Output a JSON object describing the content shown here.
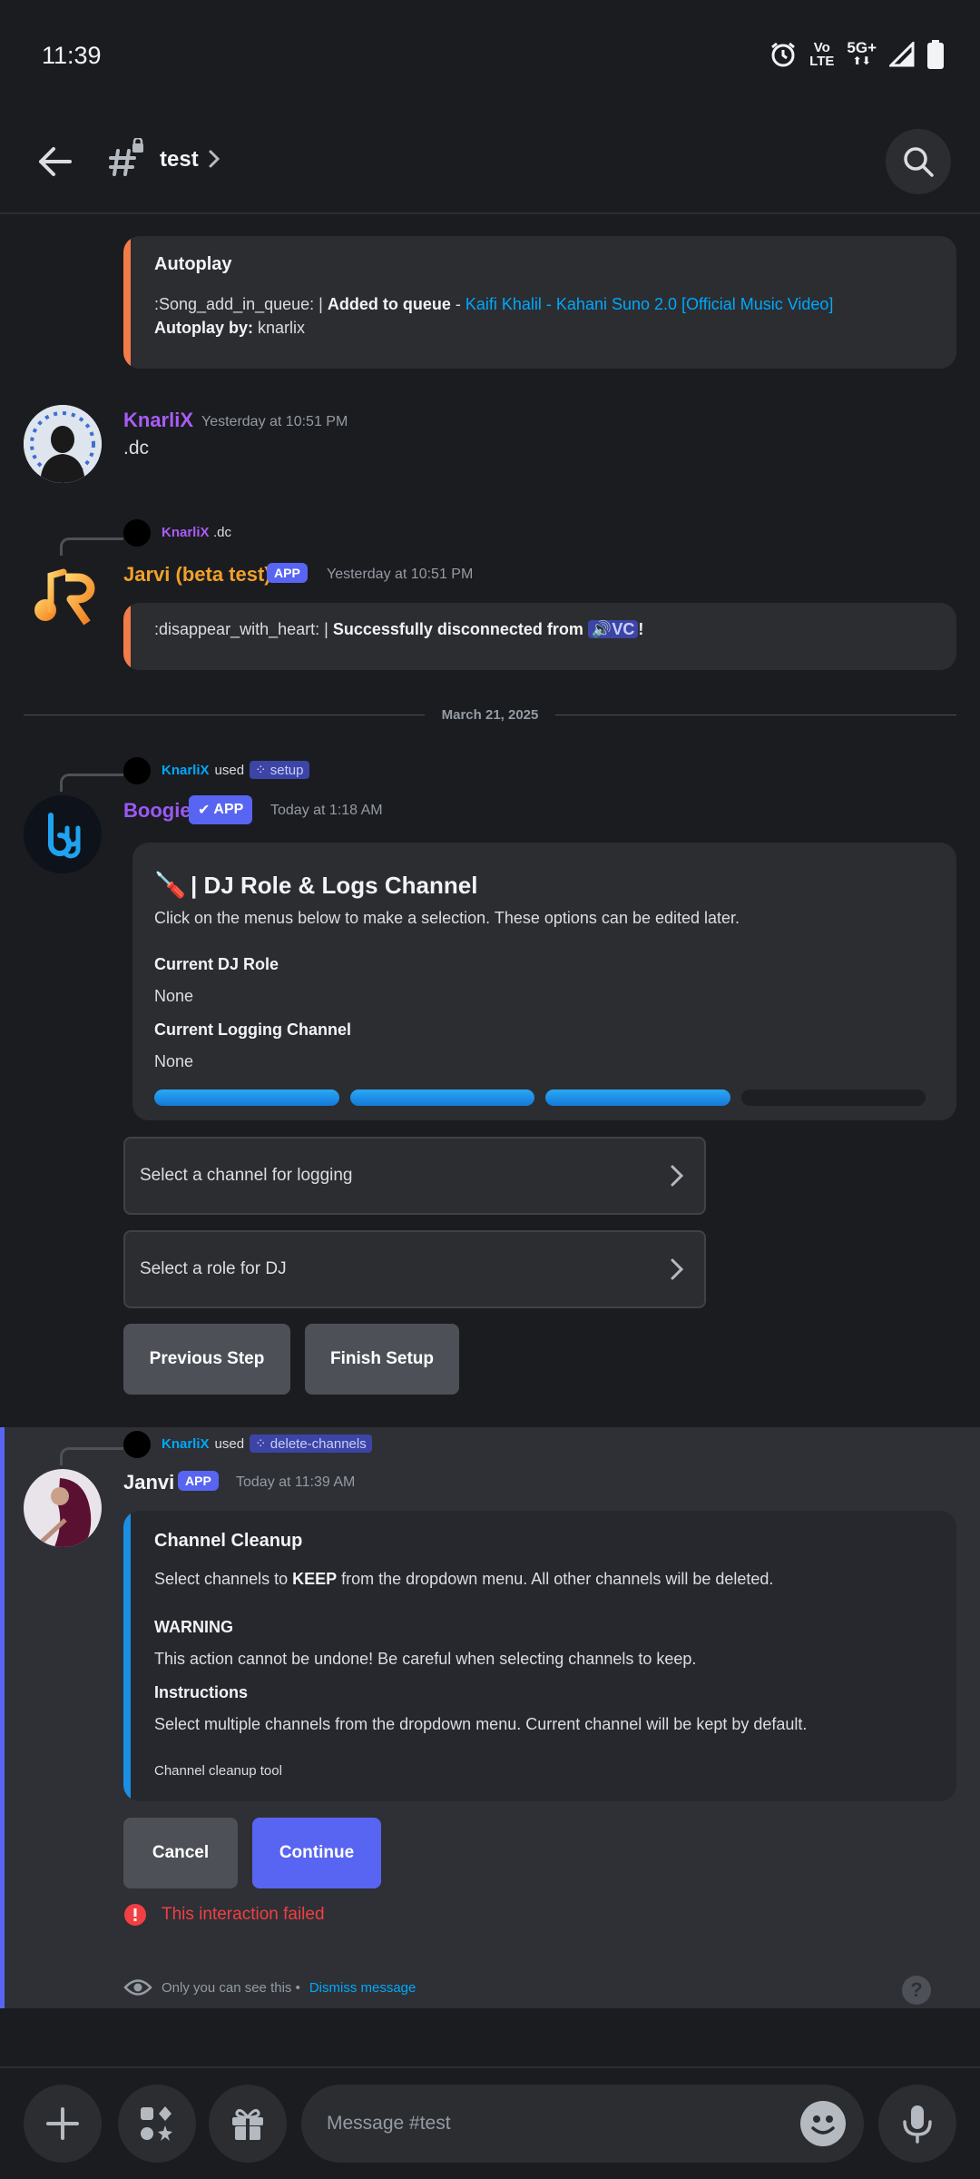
{
  "status_bar": {
    "time": "11:39",
    "volte_top": "Vo",
    "volte_bottom": "LTE",
    "network": "5G+"
  },
  "header": {
    "channel_name": "test"
  },
  "autoplay_embed": {
    "title": "Autoplay",
    "line1_prefix": ":Song_add_in_queue: |",
    "line1_bold": "Added to queue",
    "line1_sep": " - ",
    "line1_link": "Kaifi Khalil - Kahani Suno 2.0 [Official Music Video]",
    "line2_bold": "Autoplay by:",
    "line2_value": "knarlix"
  },
  "msg_knarlix": {
    "username": "KnarliX",
    "timestamp": "Yesterday at 10:51 PM",
    "text": ".dc"
  },
  "msg_jarvi": {
    "reply_name": "KnarliX",
    "reply_text": ".dc",
    "username": "Jarvi (beta test)",
    "badge": "APP",
    "timestamp": "Yesterday at 10:51 PM",
    "embed_prefix": ":disappear_with_heart: |",
    "embed_bold": "Successfully disconnected from",
    "embed_vc": "VC",
    "embed_bang": "!"
  },
  "date_divider": "March 21, 2025",
  "msg_boogie": {
    "reply_name": "KnarliX",
    "reply_used": "used",
    "reply_cmd": "setup",
    "username": "Boogie",
    "badge": "APP",
    "timestamp": "Today at 1:18 AM",
    "embed_title_icon": "🪛",
    "embed_title": "| DJ Role & Logs Channel",
    "embed_desc": "Click on the menus below to make a selection. These options can be edited later.",
    "field1_name": "Current DJ Role",
    "field1_value": "None",
    "field2_name": "Current Logging Channel",
    "field2_value": "None",
    "progress_filled_steps": 3,
    "progress_total_steps": 4,
    "select_logging": "Select a channel for logging",
    "select_dj": "Select a role for DJ",
    "btn_prev": "Previous Step",
    "btn_finish": "Finish Setup"
  },
  "msg_janvi": {
    "reply_name": "KnarliX",
    "reply_used": "used",
    "reply_cmd": "delete-channels",
    "username": "Janvi",
    "badge": "APP",
    "timestamp": "Today at 11:39 AM",
    "embed_title": "Channel Cleanup",
    "line1_a": "Select channels to ",
    "line1_bold": "KEEP",
    "line1_b": " from the dropdown menu. All other channels will be deleted.",
    "warning_title": "WARNING",
    "warning_text": "This action cannot be undone! Be careful when selecting channels to keep.",
    "instructions_title": "Instructions",
    "instructions_text": "Select multiple channels from the dropdown menu. Current channel will be kept by default.",
    "footer": "Channel cleanup tool",
    "btn_cancel": "Cancel",
    "btn_continue": "Continue",
    "error_text": "This interaction failed",
    "ephemeral_note": "Only you can see this •",
    "dismiss": "Dismiss message"
  },
  "composer": {
    "placeholder": "Message #test"
  },
  "colors": {
    "bg": "#1b1c20",
    "embed": "#2b2d31",
    "orange_bar": "#f47b4a",
    "blue_bar": "#1a8fe3",
    "blurple": "#5865f2",
    "link": "#00a8fc",
    "knarlix": "#a95cf6",
    "jarvi": "#f0a12b",
    "boogie": "#9b59f6",
    "error": "#f23f43"
  }
}
